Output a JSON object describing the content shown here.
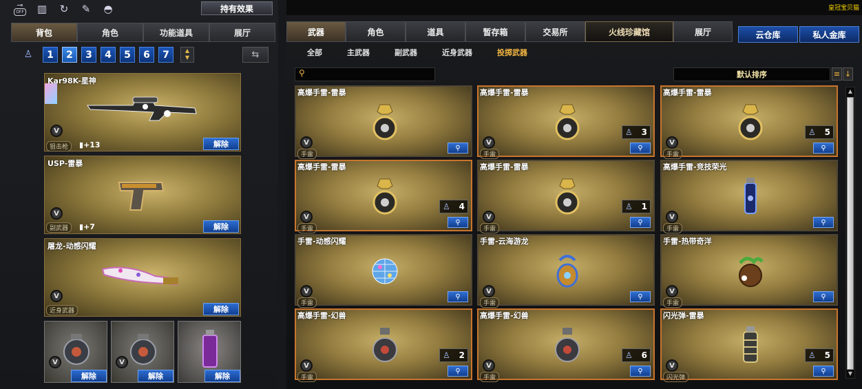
{
  "top_icons": [
    "off-toggle-icon",
    "gift-icon",
    "refresh-icon",
    "brush-icon",
    "bag-icon"
  ],
  "off_label": "OFF",
  "hold_effect_label": "持有效果",
  "left_tabs": [
    "背包",
    "角色",
    "功能道具",
    "展厅"
  ],
  "left_active_tab": 0,
  "pages": [
    "1",
    "2",
    "3",
    "4",
    "5",
    "6",
    "7"
  ],
  "active_page": "2",
  "loadout": [
    {
      "name": "Kar98K-星神",
      "category": "狙击枪",
      "plus": "+13",
      "unequip": "解除"
    },
    {
      "name": "USP-雷暴",
      "category": "副武器",
      "plus": "+7",
      "unequip": "解除"
    },
    {
      "name": "屠龙-动感闪耀",
      "category": "近身武器",
      "plus": "",
      "unequip": "解除"
    }
  ],
  "slots": [
    {
      "unequip": "解除",
      "kind": "grenade"
    },
    {
      "unequip": "解除",
      "kind": "grenade"
    },
    {
      "unequip": "解除",
      "kind": "smoke"
    }
  ],
  "v_label": "V",
  "right_tabs": [
    "武器",
    "角色",
    "道具",
    "暂存箱",
    "交易所",
    "火线珍藏馆",
    "展厅"
  ],
  "right_active_tab": 0,
  "cloud_tabs": [
    "云仓库",
    "私人金库"
  ],
  "ticker": "皇冠宝贝猫",
  "sub_tabs": [
    "全部",
    "主武器",
    "副武器",
    "近身武器",
    "投掷武器"
  ],
  "sub_active_tab": 4,
  "search": {
    "value": "",
    "placeholder": ""
  },
  "sort_label": "默认排序",
  "items": [
    {
      "name": "高爆手雷-雷暴",
      "category": "手雷",
      "count": "",
      "sel": false,
      "kind": "grenade-gold"
    },
    {
      "name": "高爆手雷-雷暴",
      "category": "手雷",
      "count": "3",
      "sel": true,
      "kind": "grenade-gold"
    },
    {
      "name": "高爆手雷-雷暴",
      "category": "手雷",
      "count": "5",
      "sel": true,
      "kind": "grenade-gold"
    },
    {
      "name": "高爆手雷-雷暴",
      "category": "手雷",
      "count": "4",
      "sel": true,
      "kind": "grenade-gold"
    },
    {
      "name": "高爆手雷-雷暴",
      "category": "手雷",
      "count": "1",
      "sel": false,
      "kind": "grenade-gold"
    },
    {
      "name": "高爆手雷-竞技荣光",
      "category": "手雷",
      "count": "",
      "sel": false,
      "kind": "grenade-blue"
    },
    {
      "name": "手雷-动感闪耀",
      "category": "手雷",
      "count": "",
      "sel": false,
      "kind": "discoball"
    },
    {
      "name": "手雷-云海游龙",
      "category": "手雷",
      "count": "",
      "sel": false,
      "kind": "dragon"
    },
    {
      "name": "手雷-热带奇洋",
      "category": "手雷",
      "count": "",
      "sel": false,
      "kind": "coconut"
    },
    {
      "name": "高爆手雷-幻兽",
      "category": "手雷",
      "count": "2",
      "sel": true,
      "kind": "grenade-dark"
    },
    {
      "name": "高爆手雷-幻兽",
      "category": "手雷",
      "count": "6",
      "sel": true,
      "kind": "grenade-dark"
    },
    {
      "name": "闪光弹-雷暴",
      "category": "闪光弹",
      "count": "5",
      "sel": true,
      "kind": "flashbang"
    }
  ],
  "colors": {
    "accent_gold": "#f3b640",
    "blue_button": "#1b55b8",
    "selected_border": "#c9752e"
  }
}
